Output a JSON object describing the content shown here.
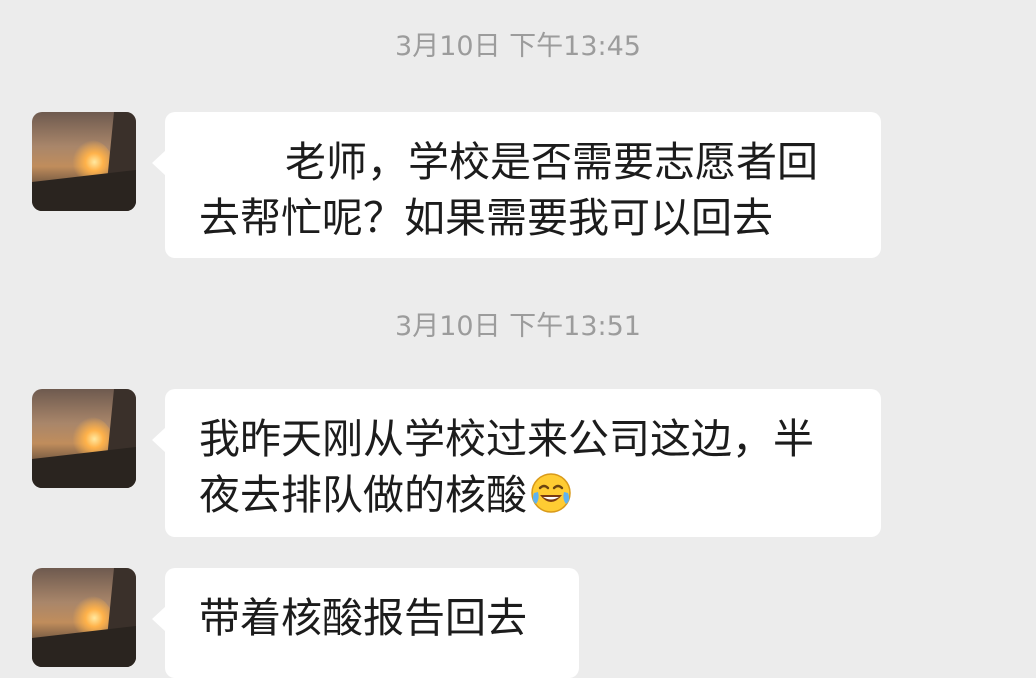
{
  "timestamps": [
    "3月10日 下午13:45",
    "3月10日 下午13:51"
  ],
  "messages": [
    {
      "lines": [
        "老师，学校是否需要志愿者回",
        "去帮忙呢？如果需要我可以回去"
      ]
    },
    {
      "lines": [
        "我昨天刚从学校过来公司这边，半",
        "夜去排队做的核酸"
      ],
      "emoji": "tears-of-joy-emoji"
    },
    {
      "lines": [
        "带着核酸报告回去"
      ]
    }
  ],
  "avatar": {
    "icon": "sunset-photo-avatar"
  }
}
